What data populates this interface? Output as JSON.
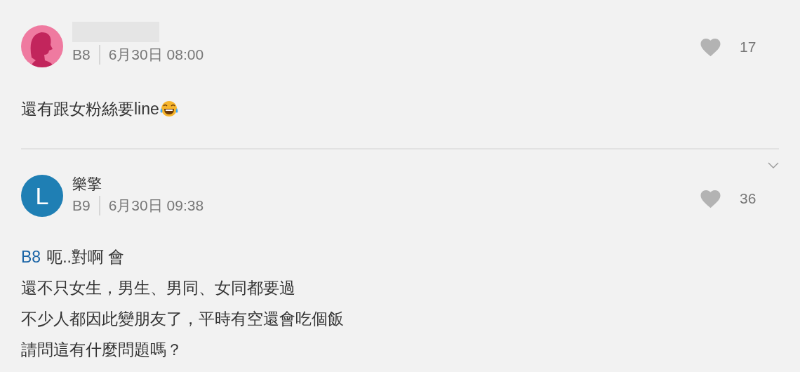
{
  "comments": [
    {
      "avatar": {
        "kind": "silhouette"
      },
      "name_redacted": true,
      "floor": "B8",
      "time": "6月30日 08:00",
      "likes": "17",
      "body": {
        "lines": [
          "還有跟女粉絲要line"
        ],
        "laughing_emoji": true
      },
      "divider_after": true
    },
    {
      "avatar": {
        "kind": "letter",
        "letter": "L"
      },
      "name_redacted": false,
      "author": "樂擎",
      "floor": "B9",
      "time": "6月30日 09:38",
      "likes": "36",
      "expand_caret": true,
      "body": {
        "reply_to": "B8",
        "lines": [
          "呃..對啊 會",
          "還不只女生，男生、男同、女同都要過",
          "不少人都因此變朋友了，平時有空還會吃個飯",
          "請問這有什麼問題嗎？"
        ]
      }
    }
  ]
}
